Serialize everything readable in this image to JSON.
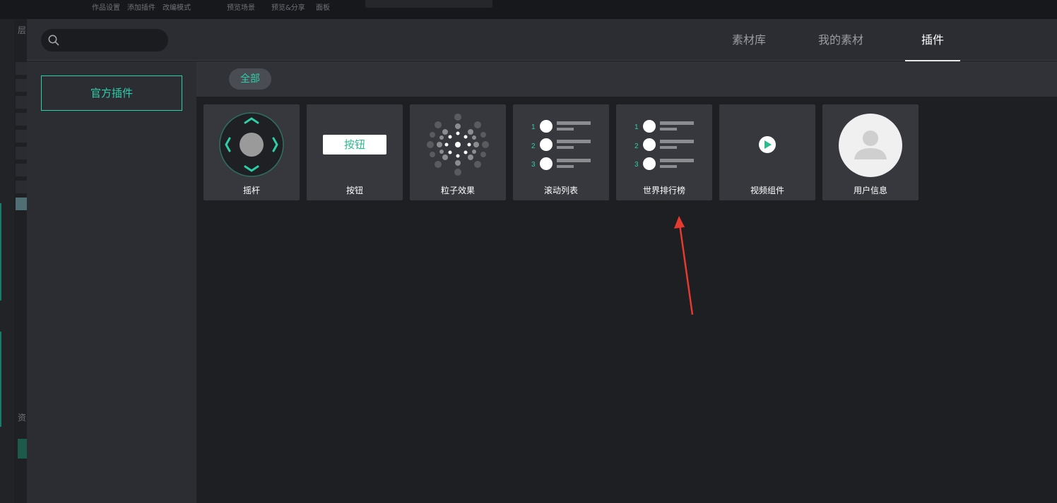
{
  "background_app": {
    "menu_items": [
      "作品设置",
      "添加插件",
      "改编模式",
      "预览场景",
      "预览&分享",
      "面板"
    ],
    "left_labels": [
      "层",
      "资"
    ]
  },
  "modal": {
    "search": {
      "placeholder": "",
      "value": ""
    },
    "tabs": [
      {
        "label": "素材库",
        "active": false
      },
      {
        "label": "我的素材",
        "active": false
      },
      {
        "label": "插件",
        "active": true
      }
    ],
    "sidebar": {
      "items": [
        {
          "label": "官方插件",
          "selected": true
        }
      ]
    },
    "filter": {
      "chips": [
        {
          "label": "全部",
          "selected": true
        }
      ]
    },
    "plugins": [
      {
        "label": "摇杆",
        "icon": "joystick-icon"
      },
      {
        "label": "按钮",
        "icon": "button-preview",
        "preview_text": "按钮"
      },
      {
        "label": "粒子效果",
        "icon": "particles-icon"
      },
      {
        "label": "滚动列表",
        "icon": "ranked-list-icon",
        "ranks": [
          "1",
          "2",
          "3"
        ]
      },
      {
        "label": "世界排行榜",
        "icon": "ranked-list-icon",
        "ranks": [
          "1",
          "2",
          "3"
        ]
      },
      {
        "label": "视频组件",
        "icon": "play-icon"
      },
      {
        "label": "用户信息",
        "icon": "user-avatar-icon"
      }
    ]
  },
  "colors": {
    "accent": "#2dcfa8",
    "annotation_arrow": "#e53a2f",
    "card_bg": "#36383e",
    "header_bg": "#2b2d33"
  }
}
